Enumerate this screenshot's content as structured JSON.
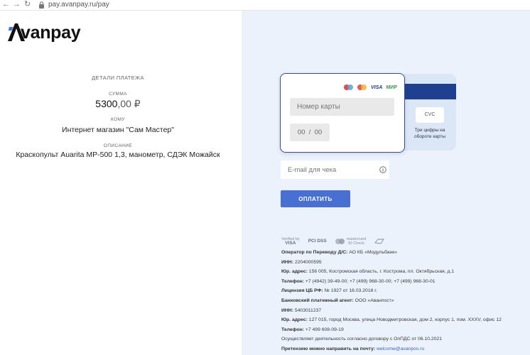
{
  "browser": {
    "url": "pay.avanpay.ru/pay",
    "back_icon": "arrow-left-icon",
    "forward_icon": "arrow-right-icon",
    "reload_icon": "reload-icon",
    "lock_icon": "lock-icon"
  },
  "brand": {
    "logo_text": "vanpay",
    "logo_letter": "A"
  },
  "details": {
    "heading": "ДЕТАЛИ ПЛАТЕЖА",
    "sum_label": "СУММА",
    "sum_int": "5300",
    "sum_dec": ",00",
    "currency": "₽",
    "to_label": "КОМУ",
    "to_value": "Интернет магазин \"Сам Мастер\"",
    "desc_label": "ОПИСАНИЕ",
    "desc_value": "Краскопульт Auarita MP-500 1,3, манометр, СДЭК Можайск"
  },
  "card": {
    "number_placeholder": "Номер карты",
    "exp_month": "00",
    "exp_sep": "/",
    "exp_year": "00",
    "cvc_label": "CVC",
    "cvc_hint": "Три цифры на обороте карты",
    "brands": {
      "visa": "VISA",
      "mir": "МИР"
    }
  },
  "email": {
    "placeholder": "E-mail для чека",
    "info_icon": "info-icon"
  },
  "pay_button": "ОПЛАТИТЬ",
  "security_logos": {
    "verified_top": "Verified by",
    "verified_bottom": "VISA",
    "pci": "PCI DSS",
    "mc_top": "mastercard",
    "mc_bottom": "ID Check"
  },
  "legal": [
    {
      "label": "Оператор по Переводу Д/С:",
      "value": " АО КБ «Модульбанк»"
    },
    {
      "label": "ИНН:",
      "value": " 2204000595"
    },
    {
      "label": "Юр. адрес:",
      "value": " 156 005, Костромская область, г. Кострома, пл. Октябрьская, д.1"
    },
    {
      "label": "Телефон:",
      "value": " +7 (4942) 39-49-00; +7 (499) 968-30-00; +7 (499) 968-30-01"
    },
    {
      "label": "Лицензия ЦБ РФ:",
      "value": " № 1927 от 16.03.2016 г."
    },
    {
      "label": "Банковский платежный агент:",
      "value": " ООО «Аванпост»"
    },
    {
      "label": "ИНН:",
      "value": " 5403011237"
    },
    {
      "label": "Юр. адрес:",
      "value": " 127 015, город Москва, улица Новодмитровская, дом 2, корпус 1, пом. XXXV, офис 12"
    },
    {
      "label": "Телефон:",
      "value": " +7 499 608-09-19"
    },
    {
      "label": "",
      "value": "Осуществляет деятельность согласно договору с ОпПДС от 06.10.2021"
    },
    {
      "label": "Претензию можно направить на почту:",
      "value": " ",
      "link": "welcome@avanpos.ru"
    }
  ],
  "colors": {
    "accent": "#4870d2",
    "card_border": "#2e4e97",
    "pane_bg": "#ecf2fb",
    "stripe": "#1f3f8f"
  }
}
